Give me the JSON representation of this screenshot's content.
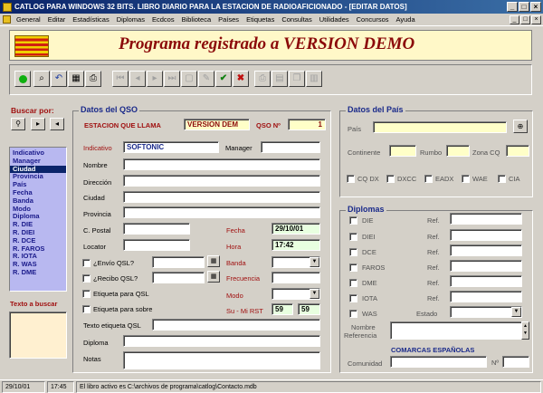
{
  "window": {
    "title": "CATLOG PARA WINDOWS 32 BITS. LIBRO DIARIO PARA LA ESTACION DE RADIOAFICIONADO - [EDITAR DATOS]",
    "buttons": [
      "_",
      "□",
      "×"
    ]
  },
  "menu": [
    "General",
    "Editar",
    "Estadísticas",
    "Diplomas",
    "Ecdcos",
    "Biblioteca",
    "Países",
    "Etiquetas",
    "Consultas",
    "Utilidades",
    "Concursos",
    "Ayuda"
  ],
  "mdi_buttons": [
    "_",
    "□",
    "×"
  ],
  "banner": {
    "title": "Programa registrado a VERSION DEMO"
  },
  "toolbar": {
    "buttons": [
      "green-dot-icon",
      "zoom-icon",
      "undo-icon",
      "grid-icon",
      "print-icon",
      "first-icon",
      "prev-icon",
      "next-icon",
      "last-icon",
      "new-icon",
      "edit-icon",
      "confirm-icon",
      "delete-icon",
      "print2-icon",
      "report-icon",
      "copy-icon",
      "tools-icon"
    ]
  },
  "search": {
    "title": "Buscar por:",
    "nav": [
      "⏭",
      "▸",
      "◂"
    ],
    "items": [
      "Indicativo",
      "Manager",
      "Ciudad",
      "Provincia",
      "País",
      "Fecha",
      "Banda",
      "Modo",
      "Diploma",
      "R. DIE",
      "R. DIEI",
      "R. DCE",
      "R. FAROS",
      "R. IOTA",
      "R. WAS",
      "R. DME"
    ],
    "selected": "Ciudad",
    "text_title": "Texto a buscar"
  },
  "qso": {
    "title": "Datos del QSO",
    "estacion_label": "ESTACION QUE LLAMA",
    "estacion_value": "VERSION DEM",
    "qso_n_label": "QSO Nº",
    "qso_n_value": "1",
    "indicativo_label": "Indicativo",
    "indicativo_value": "SOFTONIC",
    "manager_label": "Manager",
    "nombre_label": "Nombre",
    "direccion_label": "Dirección",
    "ciudad_label": "Ciudad",
    "provincia_label": "Provincia",
    "cpostal_label": "C. Postal",
    "locator_label": "Locator",
    "fecha_label": "Fecha",
    "fecha_value": "29/10/01",
    "hora_label": "Hora",
    "hora_value": "17:42",
    "envio_label": "¿Envío QSL?",
    "recibo_label": "¿Recibo QSL?",
    "banda_label": "Banda",
    "frecuencia_label": "Frecuencia",
    "etiqueta_qsl_label": "Etiqueta para QSL",
    "etiqueta_sobre_label": "Etiqueta para sobre",
    "modo_label": "Modo",
    "rst_label": "Su - Mi RST",
    "rst_su": "59",
    "rst_mi": "59",
    "texto_etiqueta_label": "Texto etiqueta QSL",
    "diploma_label": "Diploma",
    "notas_label": "Notas"
  },
  "pais": {
    "title": "Datos del País",
    "pais_label": "País",
    "continente_label": "Continente",
    "rumbo_label": "Rumbo",
    "zona_label": "Zona CQ",
    "checks": [
      "CQ DX",
      "DXCC",
      "EADX",
      "WAE",
      "CIA"
    ]
  },
  "diplomas": {
    "title": "Diplomas",
    "items": [
      "DIE",
      "DIEI",
      "DCE",
      "FAROS",
      "DME",
      "IOTA",
      "WAS"
    ],
    "ref_label": "Ref.",
    "estado_label": "Estado",
    "nombre_ref_label_1": "Nombre",
    "nombre_ref_label_2": "Referencia",
    "comarcas_title": "COMARCAS ESPAÑOLAS",
    "comunidad_label": "Comunidad",
    "n_label": "Nº"
  },
  "status": {
    "date": "29/10/01",
    "time": "17:45",
    "message": "El libro activo es C:\\archivos de programa\\catlog\\Contacto.mdb"
  },
  "colors": {
    "title_bar": "#0a246a",
    "banner_bg": "#fff8c8",
    "banner_text": "#8b0a0a",
    "group_title": "#1a2a8a",
    "list_bg": "#b8b8f0",
    "list_selected": "#0a246a",
    "yellow_field": "#ffffc8"
  }
}
